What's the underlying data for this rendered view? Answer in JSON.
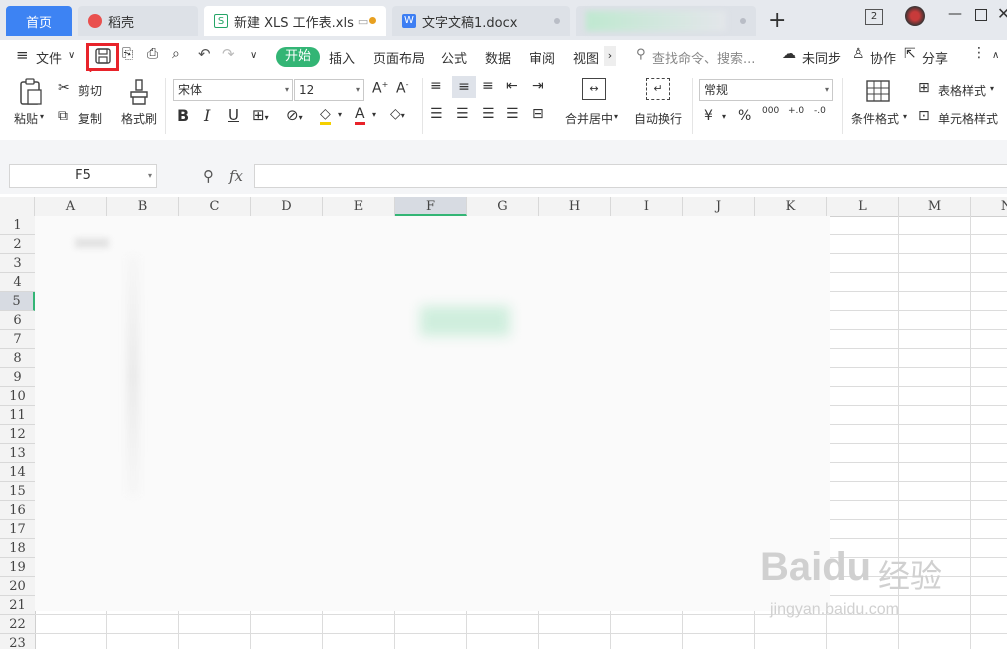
{
  "tabs": {
    "home": "首页",
    "docer": "稻壳",
    "xls": "新建 XLS 工作表.xls",
    "docx": "文字文稿1.docx",
    "add": "+",
    "badge": "2"
  },
  "menu": {
    "file": "文件",
    "start": "开始",
    "insert": "插入",
    "layout": "页面布局",
    "formula": "公式",
    "data": "数据",
    "review": "审阅",
    "view": "视图",
    "search_placeholder": "查找命令、搜索...",
    "unsync": "未同步",
    "collab": "协作",
    "share": "分享"
  },
  "ribbon": {
    "paste": "粘贴",
    "cut": "剪切",
    "copy": "复制",
    "format_painter": "格式刷",
    "font_name": "宋体",
    "font_size": "12",
    "merge_center": "合并居中",
    "wrap_text": "自动换行",
    "number_format": "常规",
    "cond_format": "条件格式",
    "table_style": "表格样式",
    "cell_style": "单元格样式",
    "bold": "B",
    "italic": "I",
    "underline": "U",
    "currency": "¥",
    "percent": "%",
    "thousands": "000",
    "dec_inc": "+.0",
    "dec_dec": "-.0"
  },
  "formula_bar": {
    "cell_ref": "F5",
    "fx": "fx"
  },
  "columns": [
    "A",
    "B",
    "C",
    "D",
    "E",
    "F",
    "G",
    "H",
    "I",
    "J",
    "K",
    "L",
    "M",
    "N"
  ],
  "rows": [
    "1",
    "2",
    "3",
    "4",
    "5",
    "6",
    "7",
    "8",
    "9",
    "10",
    "11",
    "12",
    "13",
    "14",
    "15",
    "16",
    "17",
    "18",
    "19",
    "20",
    "21",
    "22",
    "23"
  ],
  "watermark": {
    "brand": "Baidu",
    "brand_cn": "经验",
    "url": "jingyan.baidu.com"
  },
  "colors": {
    "tab_active": "#3d83f3",
    "start_green": "#33b575",
    "highlight_red": "#e8232a"
  }
}
